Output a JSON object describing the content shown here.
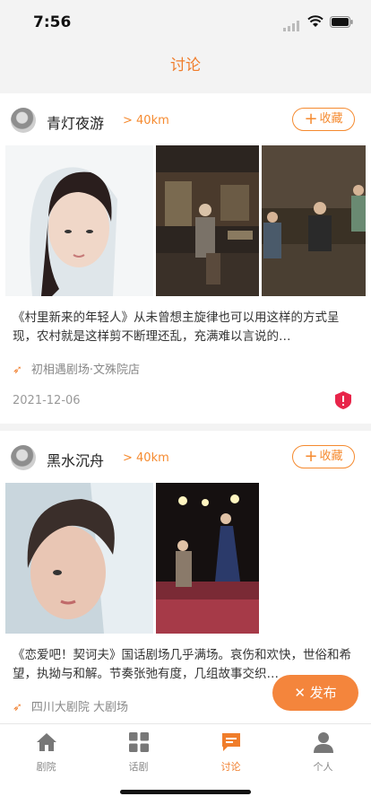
{
  "status": {
    "time": "7:56"
  },
  "nav": {
    "title": "讨论"
  },
  "posts": [
    {
      "user": "青灯夜游",
      "distance": "> 40km",
      "follow": "收藏",
      "text": "《村里新来的年轻人》从未曾想主旋律也可以用这样的方式呈现，农村就是这样剪不断理还乱，充满难以言说的…",
      "location": "初相遇剧场·文殊院店",
      "date": "2021-12-06"
    },
    {
      "user": "黑水沉舟",
      "distance": "> 40km",
      "follow": "收藏",
      "text": "《恋爱吧！契诃夫》国话剧场几乎满场。哀伤和欢快，世俗和希望，执拗与和解。节奏张弛有度，几组故事交织…",
      "location": "四川大剧院 大剧场"
    }
  ],
  "fab": {
    "label": "发布"
  },
  "tabs": [
    {
      "label": "剧院",
      "icon": "home-icon"
    },
    {
      "label": "话剧",
      "icon": "grid-icon"
    },
    {
      "label": "讨论",
      "icon": "chat-icon"
    },
    {
      "label": "个人",
      "icon": "person-icon"
    }
  ],
  "colors": {
    "accent": "#f07d2b",
    "report": "#e8254a"
  }
}
